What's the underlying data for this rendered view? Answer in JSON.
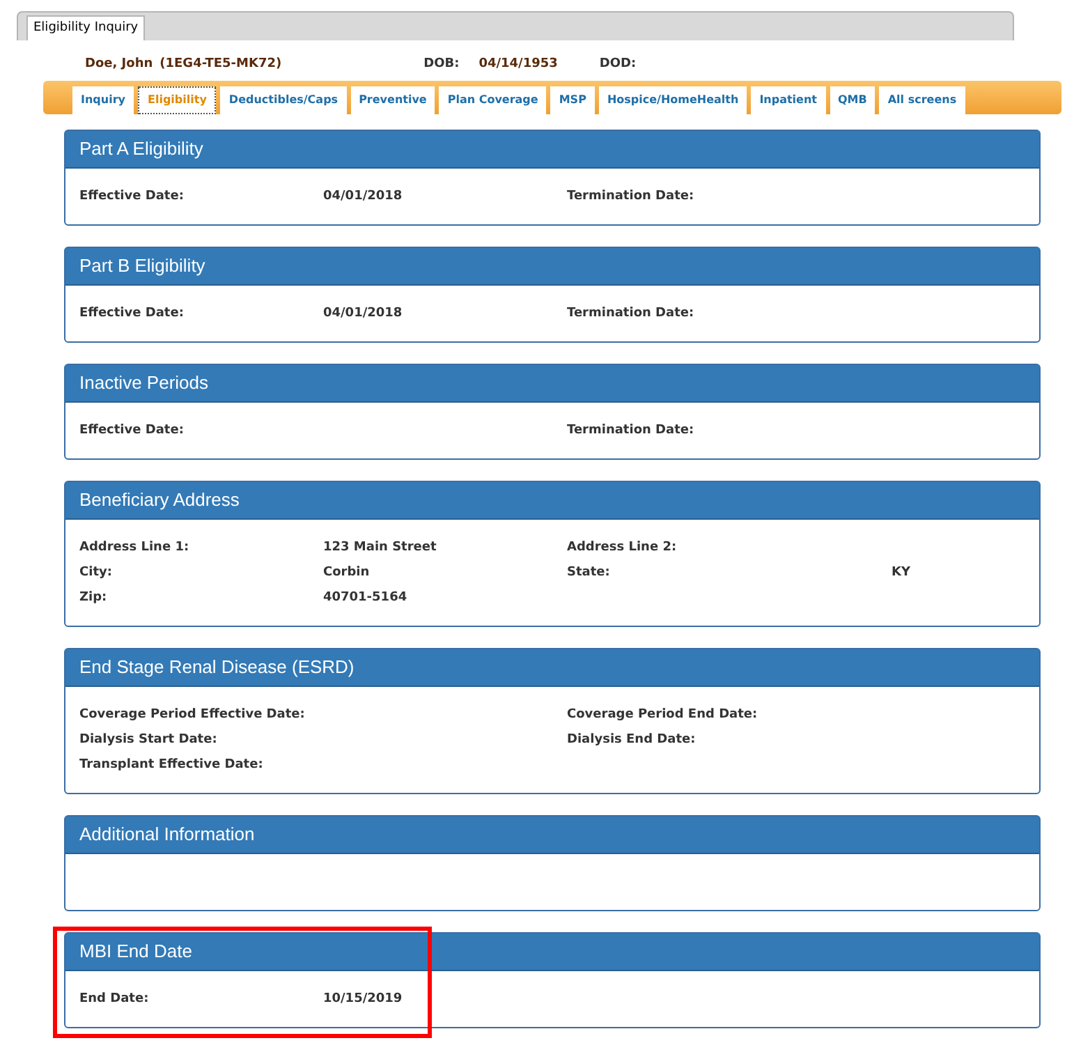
{
  "window_tab": {
    "label": "Eligibility Inquiry",
    "selected": true
  },
  "patient": {
    "name": "Doe, John",
    "id": "(1EG4-TE5-MK72)",
    "dob_label": "DOB:",
    "dob": "04/14/1953",
    "dod_label": "DOD:"
  },
  "tabs": [
    {
      "label": "Inquiry",
      "selected": false
    },
    {
      "label": "Eligibility",
      "selected": true
    },
    {
      "label": "Deductibles/Caps",
      "selected": false
    },
    {
      "label": "Preventive",
      "selected": false
    },
    {
      "label": "Plan Coverage",
      "selected": false
    },
    {
      "label": "MSP",
      "selected": false
    },
    {
      "label": "Hospice/HomeHealth",
      "selected": false
    },
    {
      "label": "Inpatient",
      "selected": false
    },
    {
      "label": "QMB",
      "selected": false
    },
    {
      "label": "All screens",
      "selected": false
    }
  ],
  "panels": [
    {
      "title": "Part A Eligibility",
      "highlighted": false,
      "rows": [
        [
          {
            "label": "Effective Date:",
            "value": "04/01/2018"
          },
          {
            "label": "Termination Date:"
          }
        ]
      ]
    },
    {
      "title": "Part B Eligibility",
      "highlighted": false,
      "rows": [
        [
          {
            "label": "Effective Date:",
            "value": "04/01/2018"
          },
          {
            "label": "Termination Date:"
          }
        ]
      ]
    },
    {
      "title": "Inactive Periods",
      "highlighted": false,
      "rows": [
        [
          {
            "label": "Effective Date:"
          },
          {
            "label": "Termination Date:"
          }
        ]
      ]
    },
    {
      "title": "Beneficiary Address",
      "highlighted": false,
      "rows": [
        [
          {
            "label": "Address Line 1:",
            "value": "123 Main Street"
          },
          {
            "label": "Address Line 2:"
          }
        ],
        [
          {
            "label": "City:",
            "value": "Corbin"
          },
          {
            "label": "State:",
            "value": "KY"
          }
        ],
        [
          {
            "label": "Zip:",
            "value": "40701-5164"
          }
        ]
      ]
    },
    {
      "title": "End Stage Renal Disease (ESRD)",
      "highlighted": false,
      "rows": [
        [
          {
            "label": "Coverage Period Effective Date:"
          },
          {
            "label": "Coverage Period End Date:"
          }
        ],
        [
          {
            "label": "Dialysis Start Date:"
          },
          {
            "label": "Dialysis End Date:"
          }
        ],
        [
          {
            "label": "Transplant Effective Date:"
          }
        ]
      ]
    },
    {
      "title": "Additional Information",
      "highlighted": false
    },
    {
      "title": "MBI End Date",
      "highlighted": true,
      "rows": [
        [
          {
            "label": "End Date:",
            "value": "10/15/2019"
          }
        ]
      ]
    }
  ]
}
